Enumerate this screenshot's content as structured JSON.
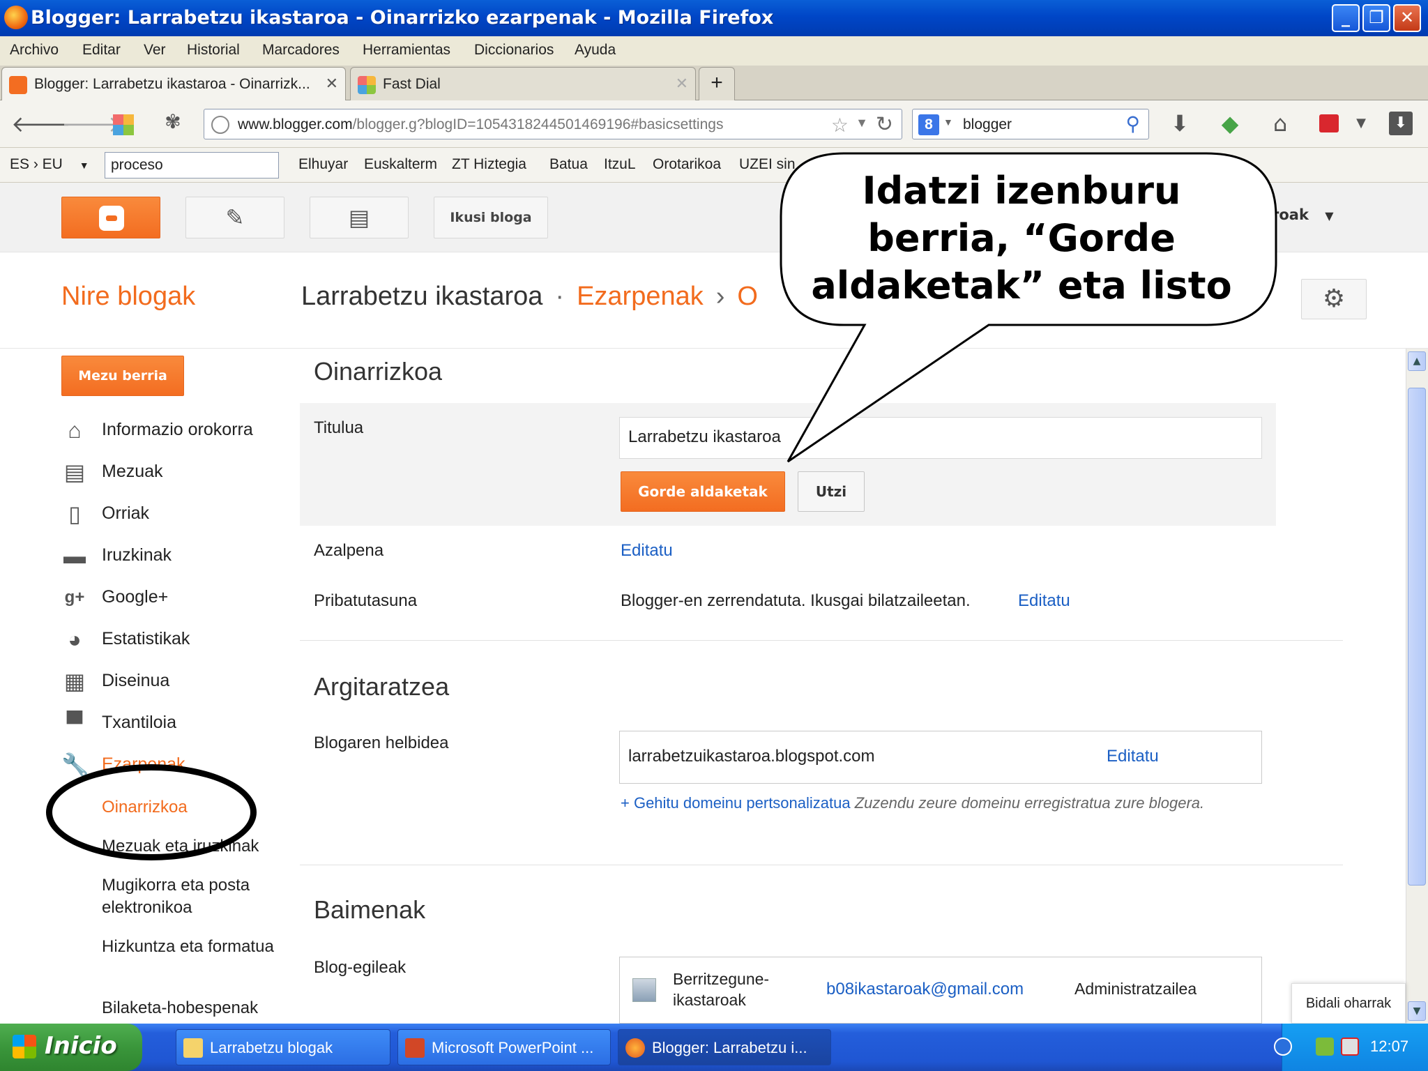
{
  "window": {
    "title": "Blogger: Larrabetzu ikastaroa - Oinarrizko ezarpenak - Mozilla Firefox",
    "controls": [
      "_",
      "❐",
      "✕"
    ]
  },
  "menu": [
    "Archivo",
    "Editar",
    "Ver",
    "Historial",
    "Marcadores",
    "Herramientas",
    "Diccionarios",
    "Ayuda"
  ],
  "tabs": [
    {
      "label": "Blogger: Larrabetzu ikastaroa - Oinarrizk...",
      "close": "✕"
    },
    {
      "label": "Fast Dial",
      "close": "✕"
    },
    {
      "label": "+"
    }
  ],
  "nav": {
    "url_host": "www.blogger.com",
    "url_rest": "/blogger.g?blogID=1054318244501469196#basicsettings",
    "search_value": "blogger",
    "search_engine": "8"
  },
  "dictbar": {
    "lang": "ES › EU",
    "input_value": "proceso",
    "bookmarks": [
      "Elhuyar",
      "Euskalterm",
      "ZT Hiztegia",
      "Batua",
      "ItzuL",
      "Orotarikoa",
      "UZEI sin"
    ]
  },
  "blogger": {
    "view_blog": "Ikusi bloga",
    "account_partial": "roak",
    "my_blogs": "Nire blogak",
    "crumb_blog": "Larrabetzu ikastaroa",
    "crumb_dot": "·",
    "crumb_settings": "Ezarpenak",
    "crumb_arrow": "›",
    "crumb_partial": "O"
  },
  "sidebar": {
    "new_post": "Mezu berria",
    "items": [
      {
        "label": "Informazio orokorra",
        "icon": "home-icon"
      },
      {
        "label": "Mezuak",
        "icon": "posts-icon"
      },
      {
        "label": "Orriak",
        "icon": "pages-icon"
      },
      {
        "label": "Iruzkinak",
        "icon": "comments-icon"
      },
      {
        "label": "Google+",
        "icon": "google-plus-icon"
      },
      {
        "label": "Estatistikak",
        "icon": "stats-icon"
      },
      {
        "label": "Diseinua",
        "icon": "layout-icon"
      },
      {
        "label": "Txantiloia",
        "icon": "template-icon"
      },
      {
        "label": "Ezarpenak",
        "icon": "wrench-icon"
      }
    ],
    "subitems": [
      "Oinarrizkoa",
      "Mezuak eta iruzkinak",
      "Mugikorra eta posta elektronikoa",
      "Hizkuntza eta formatua",
      "Bilaketa-hobespenak"
    ]
  },
  "main": {
    "basic_heading": "Oinarrizkoa",
    "title_label": "Titulua",
    "title_value": "Larrabetzu ikastaroa",
    "save_label": "Gorde aldaketak",
    "cancel_label": "Utzi",
    "desc_label": "Azalpena",
    "edit_link": "Editatu",
    "privacy_label": "Pribatutasuna",
    "privacy_value": "Blogger-en zerrendatuta. Ikusgai bilatzaileetan.",
    "publishing_heading": "Argitaratzea",
    "address_label": "Blogaren helbidea",
    "address_value": "larrabetzuikastaroa.blogspot.com",
    "add_domain_link": "+ Gehitu domeinu pertsonalizatua",
    "add_domain_note": "Zuzendu zeure domeinu erregistratua zure blogera.",
    "permissions_heading": "Baimenak",
    "authors_label": "Blog-egileak",
    "author_name": "Berritzegune-ikastaroak",
    "author_email": "b08ikastaroak@gmail.com",
    "author_role": "Administratzailea"
  },
  "feedback_label": "Bidali oharrak",
  "callout": {
    "text": "Idatzi izenburu berria, “Gorde aldaketak” eta listo"
  },
  "taskbar": {
    "start": "Inicio",
    "items": [
      "Larrabetzu blogak",
      "Microsoft PowerPoint ...",
      "Blogger: Larrabetzu i..."
    ],
    "clock": "12:07"
  },
  "colors": {
    "blogger_orange": "#f26b1d",
    "link_blue": "#1b5fc4",
    "xp_blue": "#0046c7"
  }
}
